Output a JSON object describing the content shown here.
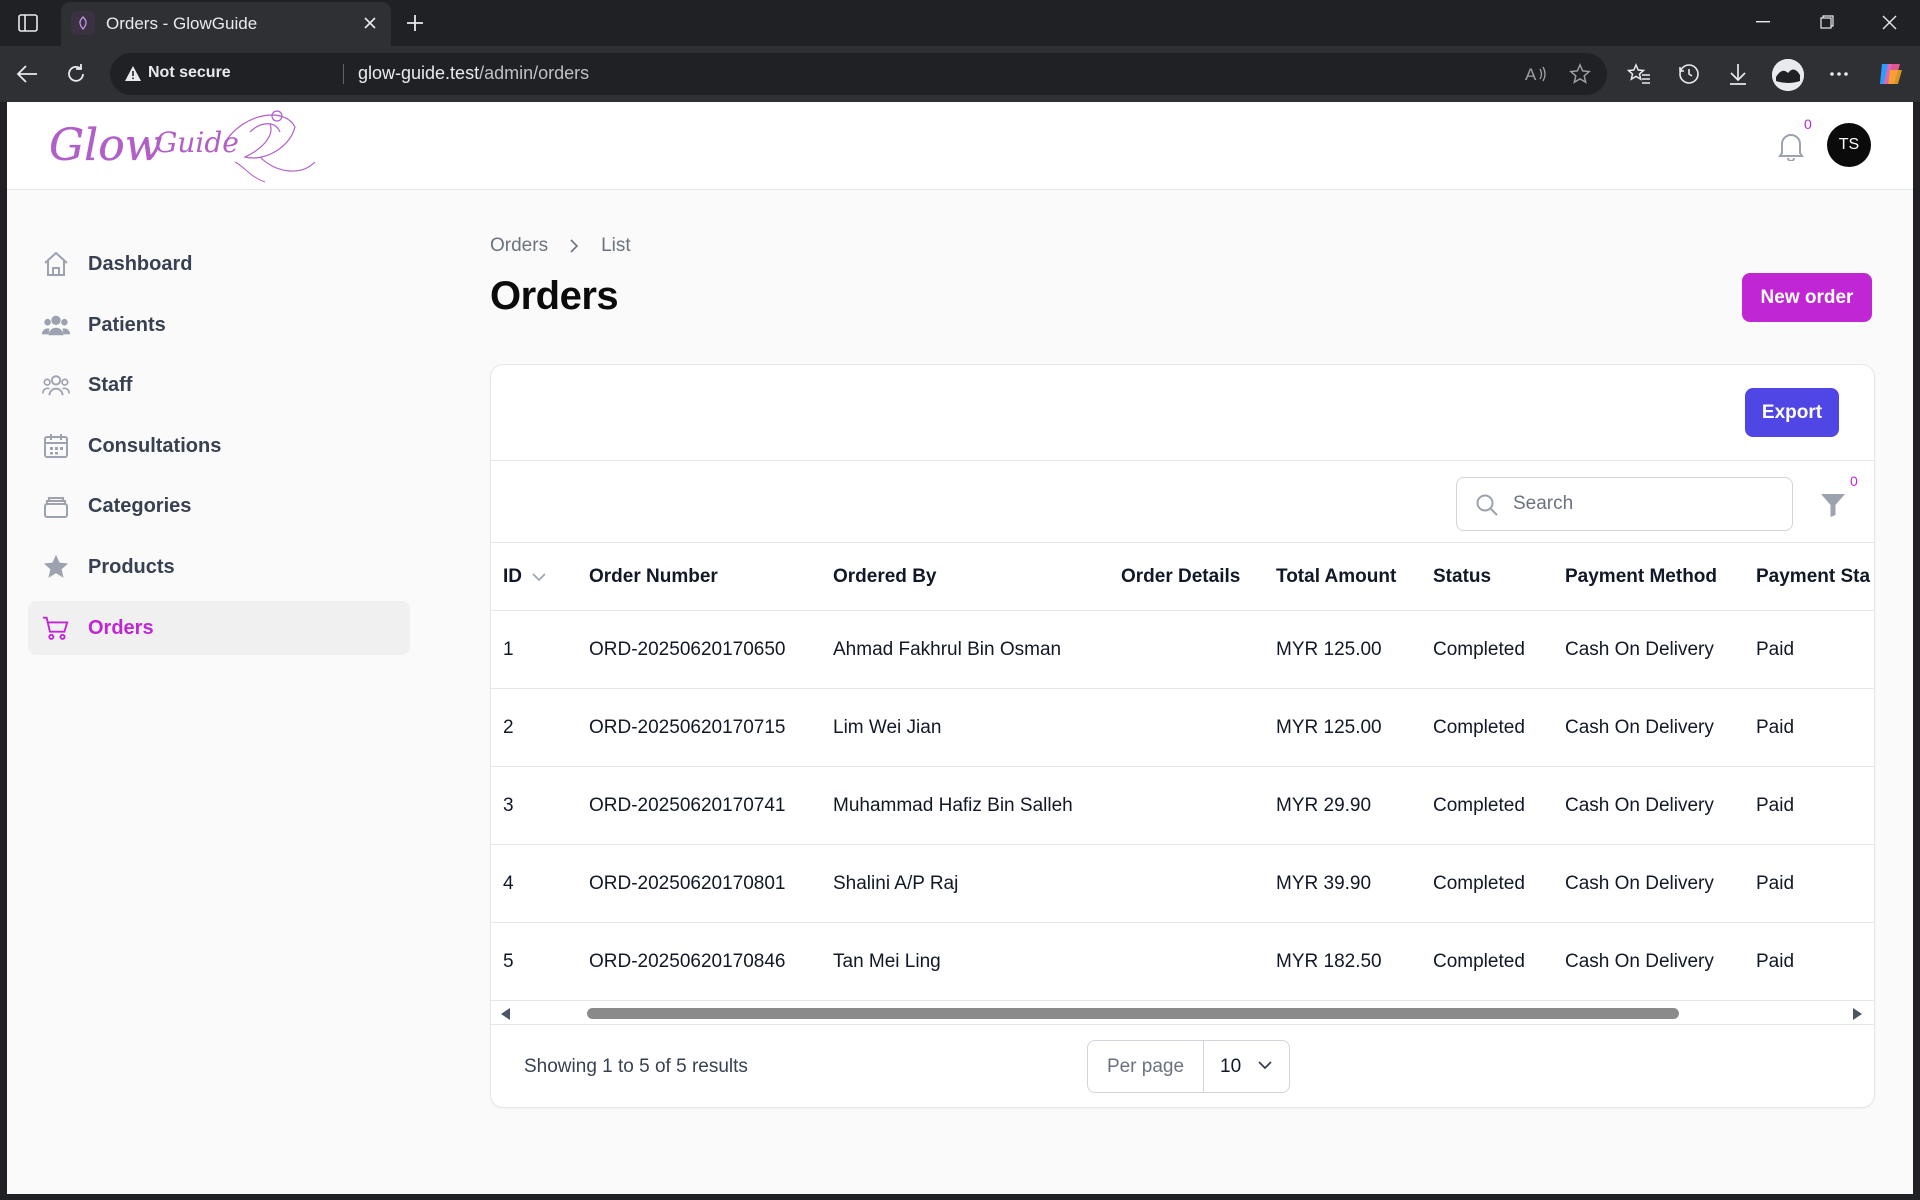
{
  "browser": {
    "tab_title": "Orders - GlowGuide",
    "security_label": "Not secure",
    "url_host": "glow-guide.test",
    "url_path": "/admin/orders"
  },
  "app": {
    "logo_text": "GlowGuide",
    "notifications_count": "0",
    "user_initials": "TS",
    "accent_color": "#c026d3",
    "export_color": "#4f46e5"
  },
  "sidebar": {
    "items": [
      {
        "label": "Dashboard",
        "icon": "home-icon"
      },
      {
        "label": "Patients",
        "icon": "users-icon"
      },
      {
        "label": "Staff",
        "icon": "staff-icon"
      },
      {
        "label": "Consultations",
        "icon": "calendar-icon"
      },
      {
        "label": "Categories",
        "icon": "layers-icon"
      },
      {
        "label": "Products",
        "icon": "star-icon"
      },
      {
        "label": "Orders",
        "icon": "cart-icon",
        "active": true
      }
    ]
  },
  "main": {
    "breadcrumb": [
      "Orders",
      "List"
    ],
    "title": "Orders",
    "new_order_label": "New order",
    "export_label": "Export",
    "search_placeholder": "Search",
    "filter_count": "0",
    "columns": [
      "ID",
      "Order Number",
      "Ordered By",
      "Order Details",
      "Total Amount",
      "Status",
      "Payment Method",
      "Payment Sta"
    ],
    "rows": [
      {
        "id": "1",
        "order_number": "ORD-20250620170650",
        "ordered_by": "Ahmad Fakhrul Bin Osman",
        "details": "",
        "total": "MYR 125.00",
        "status": "Completed",
        "method": "Cash On Delivery",
        "payment_status": "Paid"
      },
      {
        "id": "2",
        "order_number": "ORD-20250620170715",
        "ordered_by": "Lim Wei Jian",
        "details": "",
        "total": "MYR 125.00",
        "status": "Completed",
        "method": "Cash On Delivery",
        "payment_status": "Paid"
      },
      {
        "id": "3",
        "order_number": "ORD-20250620170741",
        "ordered_by": "Muhammad Hafiz Bin Salleh",
        "details": "",
        "total": "MYR 29.90",
        "status": "Completed",
        "method": "Cash On Delivery",
        "payment_status": "Paid"
      },
      {
        "id": "4",
        "order_number": "ORD-20250620170801",
        "ordered_by": "Shalini A/P Raj",
        "details": "",
        "total": "MYR 39.90",
        "status": "Completed",
        "method": "Cash On Delivery",
        "payment_status": "Paid"
      },
      {
        "id": "5",
        "order_number": "ORD-20250620170846",
        "ordered_by": "Tan Mei Ling",
        "details": "",
        "total": "MYR 182.50",
        "status": "Completed",
        "method": "Cash On Delivery",
        "payment_status": "Paid"
      }
    ],
    "showing_text": "Showing 1 to 5 of 5 results",
    "per_page_label": "Per page",
    "per_page_value": "10"
  }
}
